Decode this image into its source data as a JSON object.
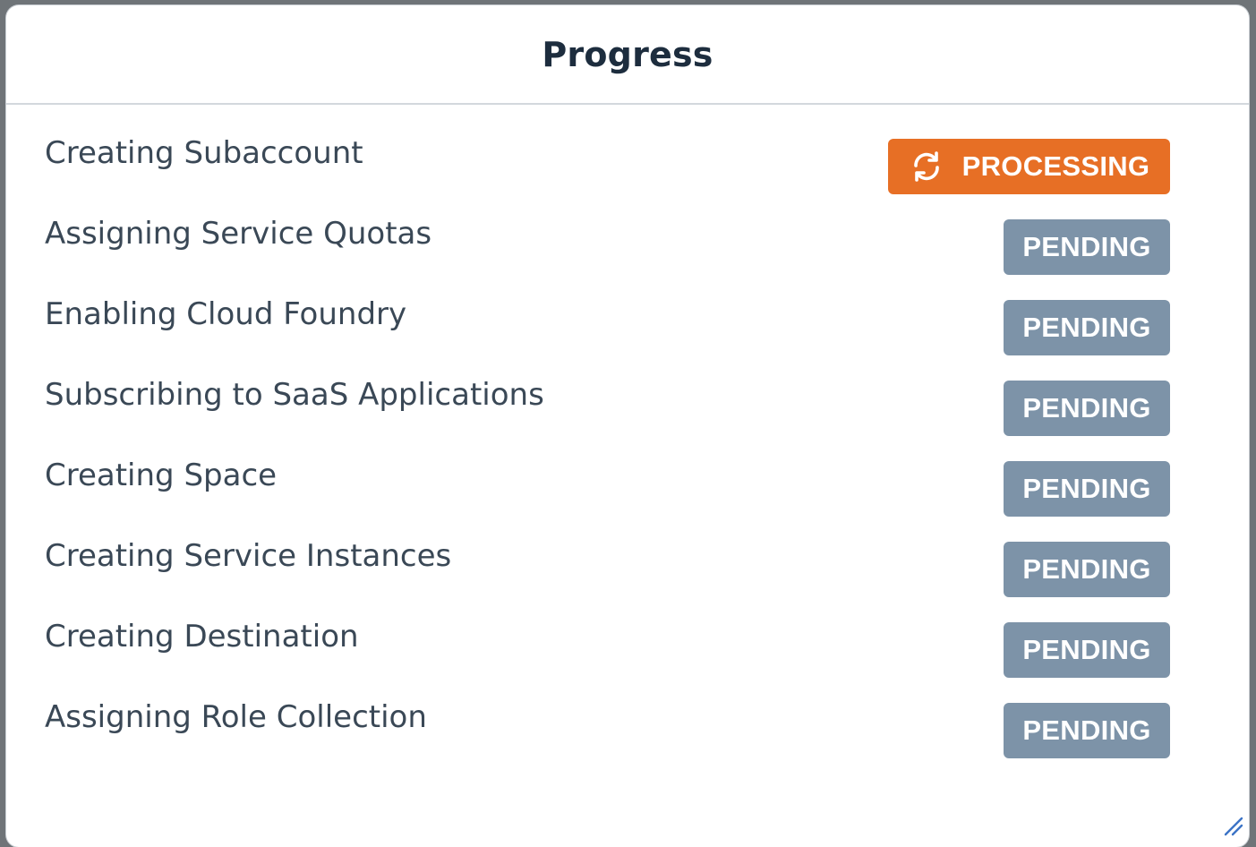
{
  "dialog": {
    "title": "Progress"
  },
  "steps": [
    {
      "label": "Creating Subaccount",
      "status": "PROCESSING",
      "status_color": "#e76f25",
      "icon": "sync-icon"
    },
    {
      "label": "Assigning Service Quotas",
      "status": "PENDING",
      "status_color": "#7d93a8"
    },
    {
      "label": "Enabling Cloud Foundry",
      "status": "PENDING",
      "status_color": "#7d93a8"
    },
    {
      "label": "Subscribing to SaaS Applications",
      "status": "PENDING",
      "status_color": "#7d93a8"
    },
    {
      "label": "Creating Space",
      "status": "PENDING",
      "status_color": "#7d93a8"
    },
    {
      "label": "Creating Service Instances",
      "status": "PENDING",
      "status_color": "#7d93a8"
    },
    {
      "label": "Creating Destination",
      "status": "PENDING",
      "status_color": "#7d93a8"
    },
    {
      "label": "Assigning Role Collection",
      "status": "PENDING",
      "status_color": "#7d93a8"
    }
  ],
  "icons": {
    "resize": "resize-grip-icon"
  }
}
